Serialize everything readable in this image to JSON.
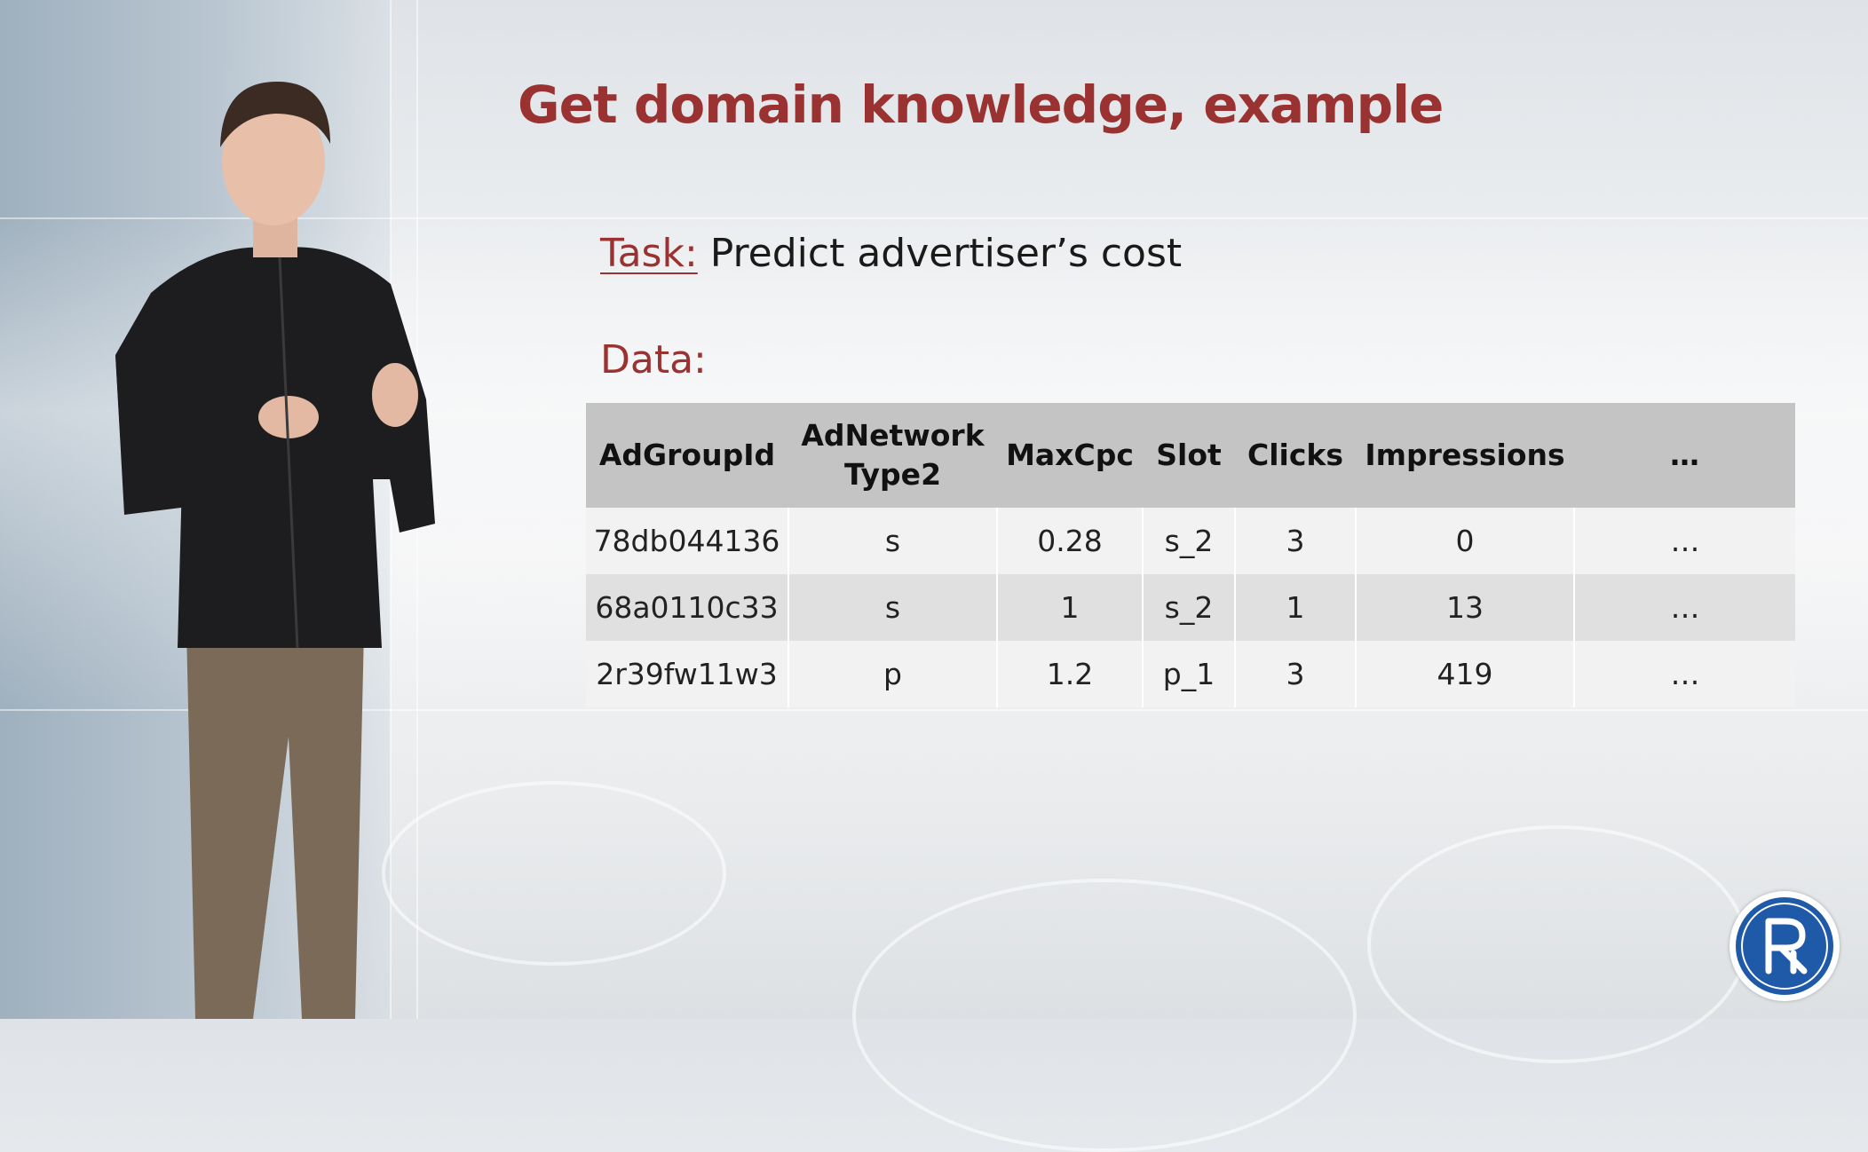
{
  "slide": {
    "title": "Get domain knowledge, example",
    "task_label": "Task:",
    "task_text": " Predict advertiser’s cost",
    "data_label": "Data:"
  },
  "table": {
    "headers": [
      "AdGroupId",
      "AdNetwork Type2",
      "MaxCpc",
      "Slot",
      "Clicks",
      "Impressions",
      "…"
    ],
    "rows": [
      [
        "78db044136",
        "s",
        "0.28",
        "s_2",
        "3",
        "0",
        "…"
      ],
      [
        "68a0110c33",
        "s",
        "1",
        "s_2",
        "1",
        "13",
        "…"
      ],
      [
        "2r39fw11w3",
        "p",
        "1.2",
        "p_1",
        "3",
        "419",
        "…"
      ]
    ]
  },
  "logo": {
    "icon": "university-logo-icon",
    "color": "#1f5aa8"
  },
  "colors": {
    "title": "#9b3232",
    "header_bg": "#c4c4c4"
  }
}
